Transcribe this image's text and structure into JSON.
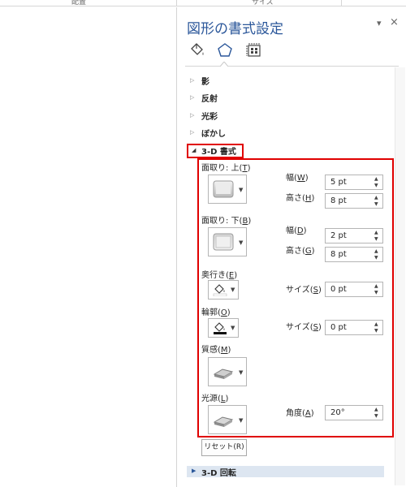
{
  "top": {
    "left_text": "配置",
    "right_text": "サイズ"
  },
  "pane": {
    "title": "図形の書式設定",
    "dropdown_glyph": "▾",
    "close_glyph": "×",
    "tabs": [
      "fill-line-icon",
      "effects-icon",
      "size-properties-icon"
    ]
  },
  "sections": {
    "shadow": "影",
    "reflection": "反射",
    "glow": "光彩",
    "soft_edges": "ぼかし",
    "three_d_format": "3-D 書式",
    "three_d_rotation": "3-D 回転"
  },
  "format3d": {
    "top_bevel": {
      "label": "面取り: 上(",
      "key": "T",
      "close": ")"
    },
    "bottom_bevel": {
      "label": "面取り: 下(",
      "key": "B",
      "close": ")"
    },
    "top_width": {
      "label": "幅(",
      "key": "W",
      "close": ")",
      "value": "5 pt"
    },
    "top_height": {
      "label": "高さ(",
      "key": "H",
      "close": ")",
      "value": "8 pt"
    },
    "bottom_width": {
      "label": "幅(",
      "key": "D",
      "close": ")",
      "value": "2 pt"
    },
    "bottom_height": {
      "label": "高さ(",
      "key": "G",
      "close": ")",
      "value": "8 pt"
    },
    "depth": {
      "label": "奥行き(",
      "key": "E",
      "close": ")"
    },
    "depth_size": {
      "label": "サイズ(",
      "key": "S",
      "close": ")",
      "value": "0 pt"
    },
    "contour": {
      "label": "輪郭(",
      "key": "O",
      "close": ")"
    },
    "contour_size": {
      "label": "サイズ(",
      "key": "S",
      "close": ")",
      "value": "0 pt"
    },
    "material": {
      "label": "質感(",
      "key": "M",
      "close": ")"
    },
    "lighting": {
      "label": "光源(",
      "key": "L",
      "close": ")"
    },
    "angle": {
      "label": "角度(",
      "key": "A",
      "close": ")",
      "value": "20°"
    },
    "reset": "リセット(R)"
  },
  "colors": {
    "accent": "#2b579a",
    "highlight": "#e00000"
  }
}
